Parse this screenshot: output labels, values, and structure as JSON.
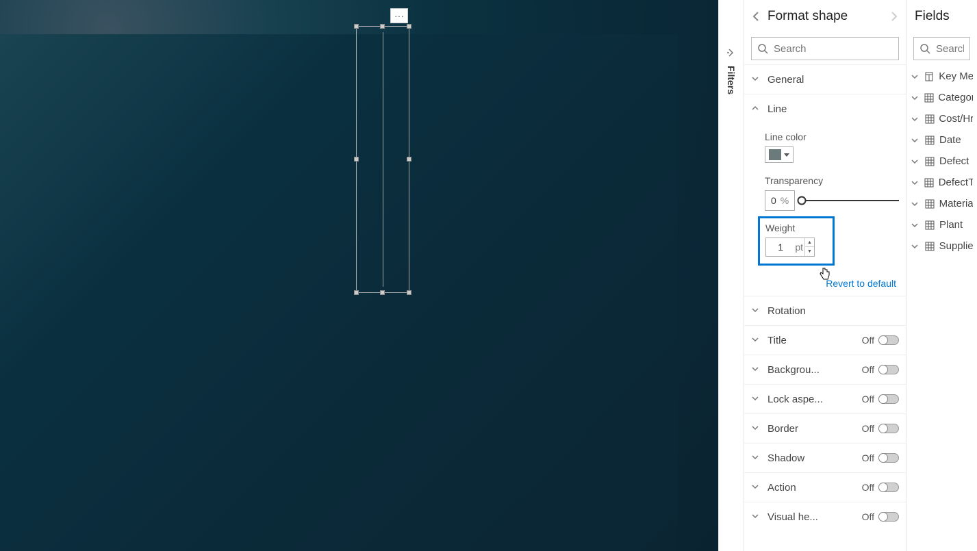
{
  "filters_tab": {
    "label": "Filters"
  },
  "canvas": {
    "visual_menu": "···"
  },
  "format_panel": {
    "title": "Format shape",
    "search_placeholder": "Search",
    "sections": {
      "general": {
        "label": "General"
      },
      "line": {
        "label": "Line",
        "line_color_label": "Line color",
        "line_color_value": "#6b7a7a",
        "transparency_label": "Transparency",
        "transparency_value": "0",
        "transparency_unit": "%",
        "weight_label": "Weight",
        "weight_value": "1",
        "weight_unit": "pt",
        "revert_label": "Revert to default"
      },
      "rotation": {
        "label": "Rotation"
      },
      "title": {
        "label": "Title",
        "state": "Off"
      },
      "background": {
        "label": "Backgrou...",
        "state": "Off"
      },
      "lock": {
        "label": "Lock aspe...",
        "state": "Off"
      },
      "border": {
        "label": "Border",
        "state": "Off"
      },
      "shadow": {
        "label": "Shadow",
        "state": "Off"
      },
      "action": {
        "label": "Action",
        "state": "Off"
      },
      "visualheader": {
        "label": "Visual he...",
        "state": "Off"
      }
    }
  },
  "fields_panel": {
    "title": "Fields",
    "search_placeholder": "Search",
    "items": [
      {
        "label": "Key Me",
        "icon": "measure"
      },
      {
        "label": "Categor",
        "icon": "table"
      },
      {
        "label": "Cost/Hr",
        "icon": "table"
      },
      {
        "label": "Date",
        "icon": "table"
      },
      {
        "label": "Defect",
        "icon": "table"
      },
      {
        "label": "DefectT",
        "icon": "table"
      },
      {
        "label": "Materia",
        "icon": "table"
      },
      {
        "label": "Plant",
        "icon": "table"
      },
      {
        "label": "Supplie",
        "icon": "table"
      }
    ]
  }
}
